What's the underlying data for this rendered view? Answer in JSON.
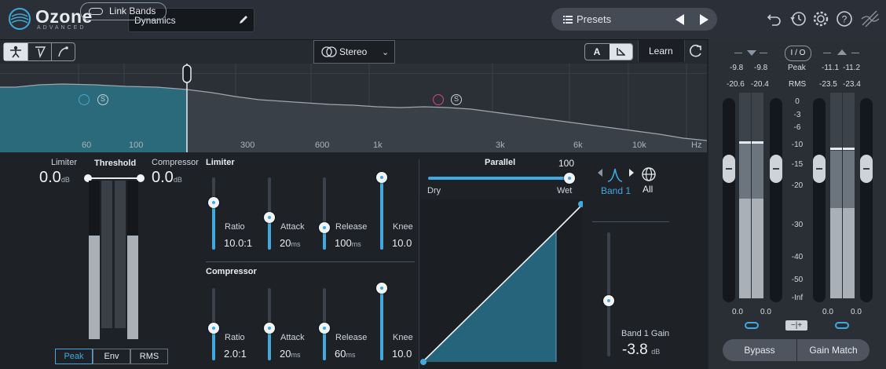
{
  "app": {
    "name": "Ozone",
    "edition": "ADVANCED"
  },
  "header": {
    "module_name": "Dynamics",
    "presets_label": "Presets",
    "icons": [
      "undo-icon",
      "history-icon",
      "gear-icon",
      "help-icon",
      "izotope-logo"
    ]
  },
  "toolbar": {
    "link_bands_label": "Link Bands",
    "stereo_mode": "Stereo",
    "a_label": "A",
    "learn_label": "Learn"
  },
  "spectrum": {
    "freq_labels": [
      "60",
      "100",
      "300",
      "600",
      "1k",
      "3k",
      "6k",
      "10k",
      "Hz"
    ],
    "band_markers": [
      "S",
      "S"
    ]
  },
  "detection": {
    "limiter_label": "Limiter",
    "limiter_value": "0.0",
    "limiter_unit": "dB",
    "threshold_label": "Threshold",
    "compressor_label": "Compressor",
    "compressor_value": "0.0",
    "compressor_unit": "dB",
    "modes": [
      "Peak",
      "Env",
      "RMS"
    ],
    "active_mode": "Peak"
  },
  "limiter": {
    "title": "Limiter",
    "params": [
      {
        "label": "Ratio",
        "value": "10.0:1",
        "unit": "",
        "level": 0.65
      },
      {
        "label": "Attack",
        "value": "20",
        "unit": "ms",
        "level": 0.45
      },
      {
        "label": "Release",
        "value": "100",
        "unit": "ms",
        "level": 0.3
      },
      {
        "label": "Knee",
        "value": "10.0",
        "unit": "",
        "level": 1.0
      }
    ]
  },
  "compressor": {
    "title": "Compressor",
    "params": [
      {
        "label": "Ratio",
        "value": "2.0:1",
        "unit": "",
        "level": 0.45
      },
      {
        "label": "Attack",
        "value": "20",
        "unit": "ms",
        "level": 0.45
      },
      {
        "label": "Release",
        "value": "60",
        "unit": "ms",
        "level": 0.45
      },
      {
        "label": "Knee",
        "value": "10.0",
        "unit": "",
        "level": 1.0
      }
    ]
  },
  "parallel": {
    "title": "Parallel",
    "value": "100",
    "dry_label": "Dry",
    "wet_label": "Wet",
    "level": 1.0
  },
  "band": {
    "band_label": "Band 1",
    "all_label": "All",
    "gain_label": "Band 1 Gain",
    "gain_value": "-3.8",
    "gain_unit": "dB",
    "gain_level": 0.45
  },
  "meters": {
    "io_label": "I / O",
    "peak_label": "Peak",
    "rms_label": "RMS",
    "input_peak": [
      "-9.8",
      "-9.8"
    ],
    "input_rms": [
      "-20.6",
      "-20.4"
    ],
    "output_peak": [
      "-11.1",
      "-11.2"
    ],
    "output_rms": [
      "-23.5",
      "-23.4"
    ],
    "scale": [
      "0",
      "-3",
      "-6",
      "-10",
      "-15",
      "-20",
      "-30",
      "-40",
      "-50",
      "-Inf"
    ],
    "input_gain": [
      "0.0",
      "0.0"
    ],
    "output_gain": [
      "0.0",
      "0.0"
    ],
    "bypass_label": "Bypass",
    "gain_match_label": "Gain Match"
  }
}
